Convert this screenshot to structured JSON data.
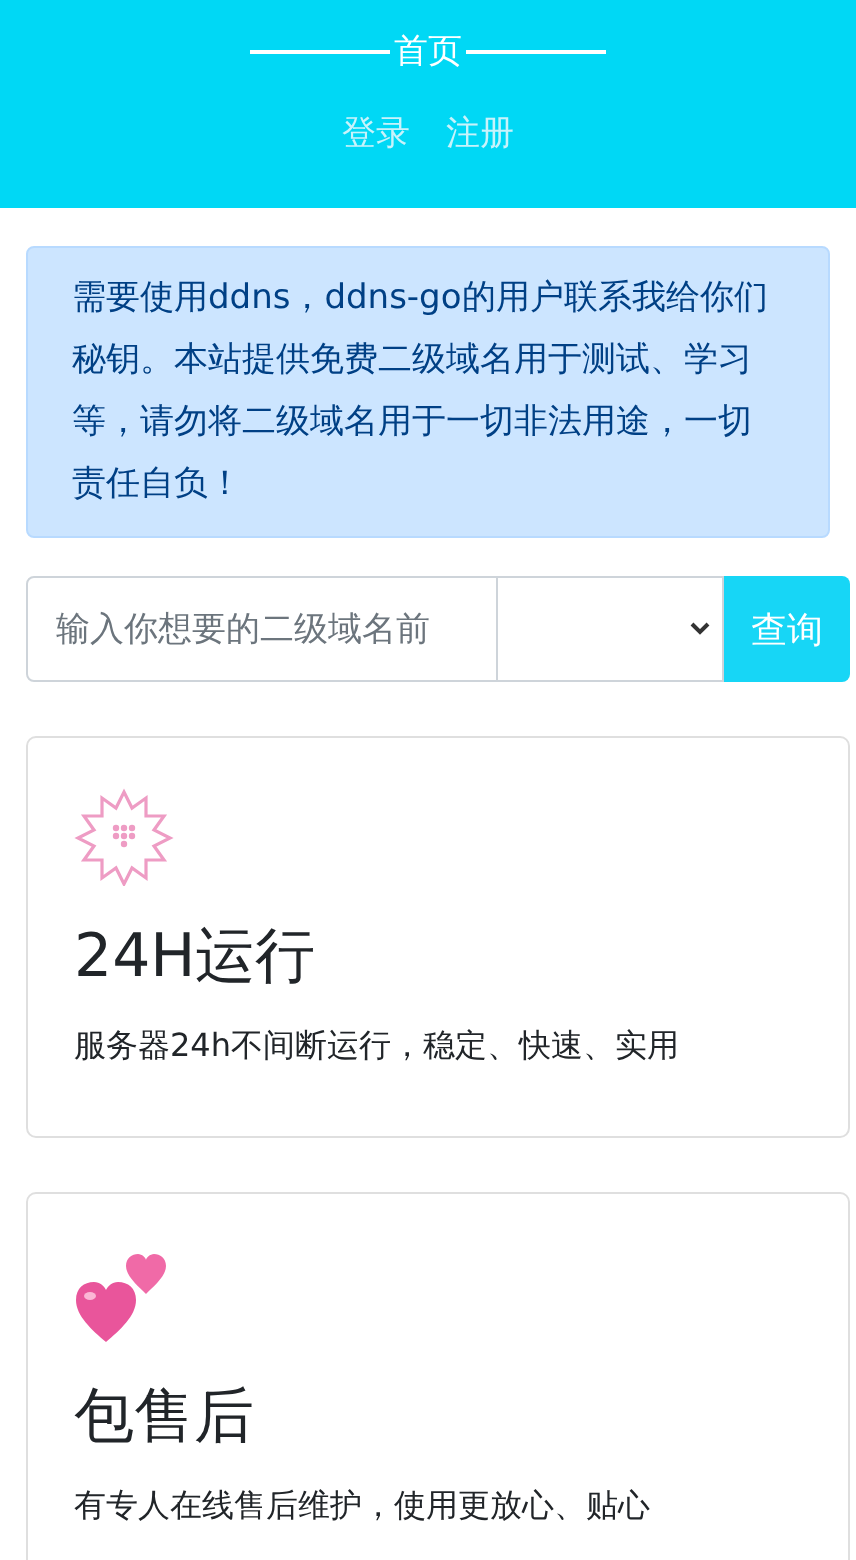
{
  "header": {
    "title": "首页",
    "links": [
      {
        "label": "登录"
      },
      {
        "label": "注册"
      }
    ]
  },
  "notice": "需要使用ddns，ddns-go的用户联系我给你们秘钥。本站提供免费二级域名用于测试、学习等，请勿将二级域名用于一切非法用途，一切责任自负！",
  "search": {
    "placeholder": "输入你想要的二级域名前",
    "button": "查询"
  },
  "features": [
    {
      "kind": "flower",
      "title": "24H运行",
      "text": "服务器24h不间断运行，稳定、快速、实用"
    },
    {
      "kind": "hearts",
      "title": "包售后",
      "text": "有专人在线售后维护，使用更放心、贴心"
    }
  ]
}
